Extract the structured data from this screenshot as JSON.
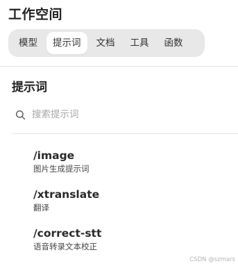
{
  "workspace": {
    "title": "工作空间"
  },
  "tabs": [
    {
      "label": "模型",
      "active": false
    },
    {
      "label": "提示词",
      "active": true
    },
    {
      "label": "文档",
      "active": false
    },
    {
      "label": "工具",
      "active": false
    },
    {
      "label": "函数",
      "active": false
    }
  ],
  "section": {
    "title": "提示词"
  },
  "search": {
    "icon": "search-icon",
    "placeholder": "搜索提示词",
    "value": ""
  },
  "prompts": [
    {
      "command": "/image",
      "description": "图片生成提示词"
    },
    {
      "command": "/xtranslate",
      "description": "翻译"
    },
    {
      "command": "/correct-stt",
      "description": "语音转录文本校正"
    }
  ],
  "watermark": "CSDN @szmars"
}
